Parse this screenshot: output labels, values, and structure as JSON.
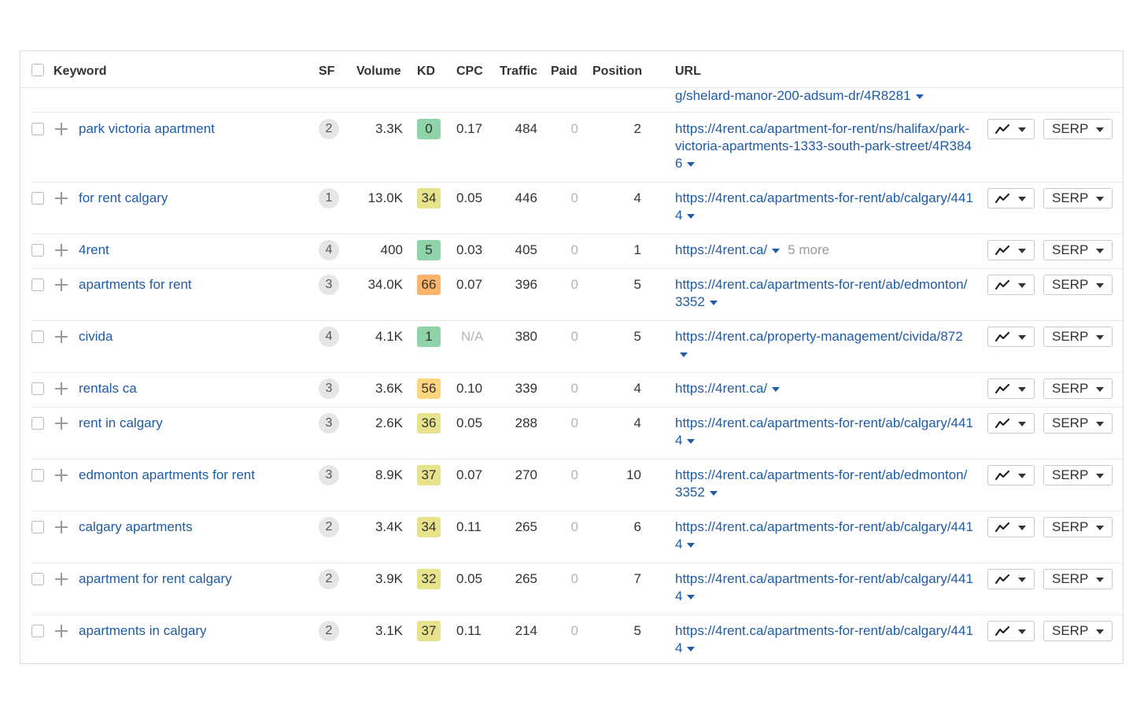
{
  "header": {
    "keyword": "Keyword",
    "sf": "SF",
    "volume": "Volume",
    "kd": "KD",
    "cpc": "CPC",
    "traffic": "Traffic",
    "paid": "Paid",
    "position": "Position",
    "url": "URL"
  },
  "partial_row": {
    "url": "g/shelard-manor-200-adsum-dr/4R8281"
  },
  "buttons": {
    "serp_label": "SERP"
  },
  "kd_colors": {
    "green": "#8fd3a8",
    "light_green": "#a5dca0",
    "yellow": "#e8e48f",
    "light_orange": "#ffd47e",
    "orange": "#ffb36b"
  },
  "rows": [
    {
      "keyword": "park victoria apartment",
      "sf": "2",
      "volume": "3.3K",
      "kd": "0",
      "kd_color": "#8fd3a8",
      "cpc": "0.17",
      "traffic": "484",
      "paid": "0",
      "position": "2",
      "url": "https://4rent.ca/apartment-for-rent/ns/halifax/park-victoria-apartments-1333-south-park-street/4R3846",
      "more": ""
    },
    {
      "keyword": "for rent calgary",
      "sf": "1",
      "volume": "13.0K",
      "kd": "34",
      "kd_color": "#e6e38c",
      "cpc": "0.05",
      "traffic": "446",
      "paid": "0",
      "position": "4",
      "url": "https://4rent.ca/apartments-for-rent/ab/calgary/4414",
      "more": ""
    },
    {
      "keyword": "4rent",
      "sf": "4",
      "volume": "400",
      "kd": "5",
      "kd_color": "#8fd3a8",
      "cpc": "0.03",
      "traffic": "405",
      "paid": "0",
      "position": "1",
      "url": "https://4rent.ca/",
      "more": "5 more"
    },
    {
      "keyword": "apartments for rent",
      "sf": "3",
      "volume": "34.0K",
      "kd": "66",
      "kd_color": "#ffb36b",
      "cpc": "0.07",
      "traffic": "396",
      "paid": "0",
      "position": "5",
      "url": "https://4rent.ca/apartments-for-rent/ab/edmonton/3352",
      "more": ""
    },
    {
      "keyword": "civida",
      "sf": "4",
      "volume": "4.1K",
      "kd": "1",
      "kd_color": "#8fd3a8",
      "cpc": "N/A",
      "traffic": "380",
      "paid": "0",
      "position": "5",
      "url": "https://4rent.ca/property-management/civida/872",
      "more": ""
    },
    {
      "keyword": "rentals ca",
      "sf": "3",
      "volume": "3.6K",
      "kd": "56",
      "kd_color": "#ffd47e",
      "cpc": "0.10",
      "traffic": "339",
      "paid": "0",
      "position": "4",
      "url": "https://4rent.ca/",
      "more": ""
    },
    {
      "keyword": "rent in calgary",
      "sf": "3",
      "volume": "2.6K",
      "kd": "36",
      "kd_color": "#e6e38c",
      "cpc": "0.05",
      "traffic": "288",
      "paid": "0",
      "position": "4",
      "url": "https://4rent.ca/apartments-for-rent/ab/calgary/4414",
      "more": ""
    },
    {
      "keyword": "edmonton apartments for rent",
      "sf": "3",
      "volume": "8.9K",
      "kd": "37",
      "kd_color": "#e6e38c",
      "cpc": "0.07",
      "traffic": "270",
      "paid": "0",
      "position": "10",
      "url": "https://4rent.ca/apartments-for-rent/ab/edmonton/3352",
      "more": ""
    },
    {
      "keyword": "calgary apartments",
      "sf": "2",
      "volume": "3.4K",
      "kd": "34",
      "kd_color": "#e6e38c",
      "cpc": "0.11",
      "traffic": "265",
      "paid": "0",
      "position": "6",
      "url": "https://4rent.ca/apartments-for-rent/ab/calgary/4414",
      "more": ""
    },
    {
      "keyword": "apartment for rent calgary",
      "sf": "2",
      "volume": "3.9K",
      "kd": "32",
      "kd_color": "#e6e38c",
      "cpc": "0.05",
      "traffic": "265",
      "paid": "0",
      "position": "7",
      "url": "https://4rent.ca/apartments-for-rent/ab/calgary/4414",
      "more": ""
    },
    {
      "keyword": "apartments in calgary",
      "sf": "2",
      "volume": "3.1K",
      "kd": "37",
      "kd_color": "#e6e38c",
      "cpc": "0.11",
      "traffic": "214",
      "paid": "0",
      "position": "5",
      "url": "https://4rent.ca/apartments-for-rent/ab/calgary/4414",
      "more": ""
    }
  ]
}
